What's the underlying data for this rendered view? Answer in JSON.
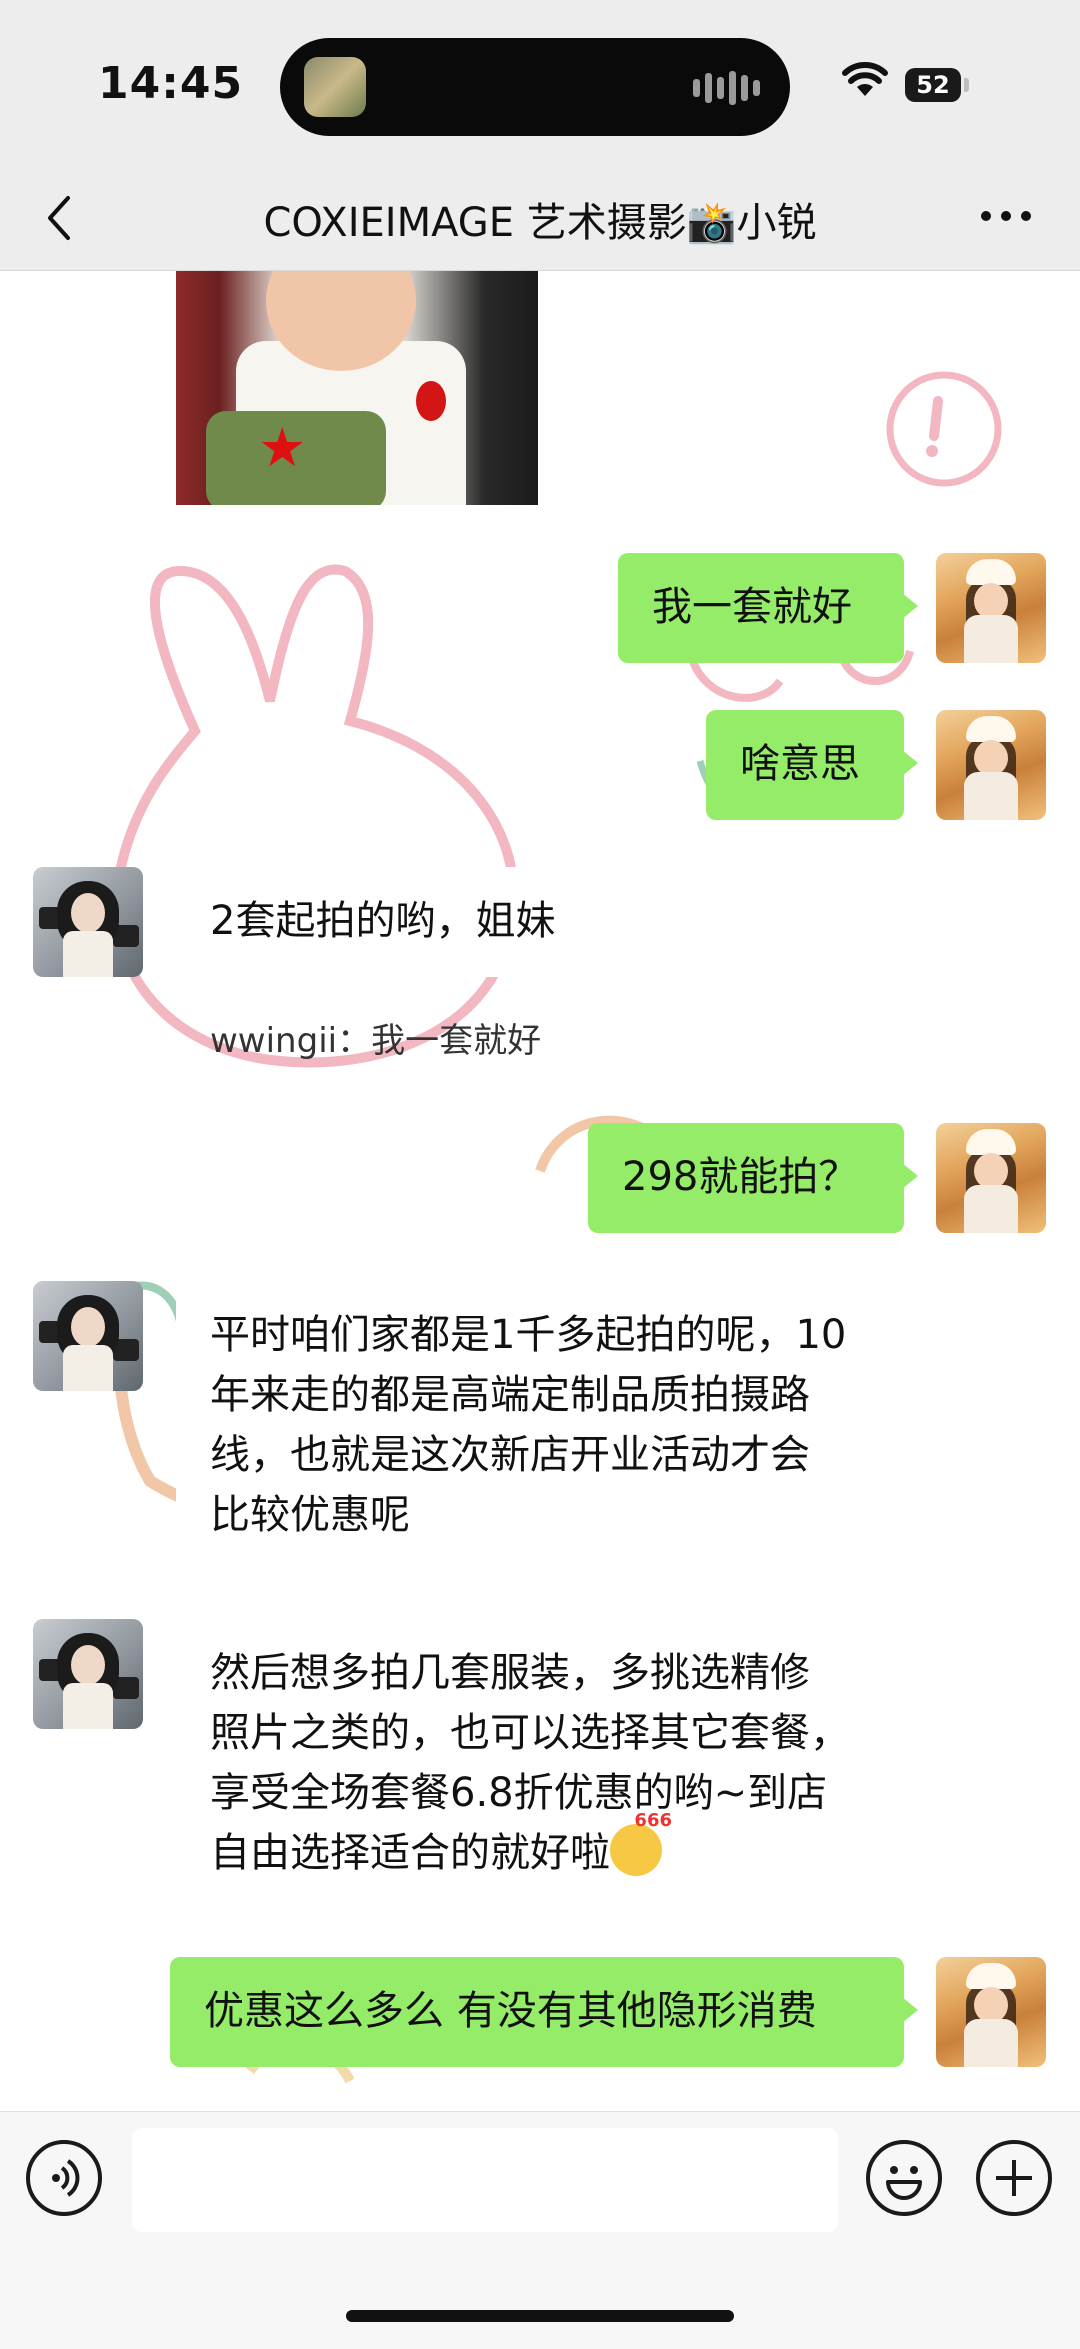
{
  "status_bar": {
    "time": "14:45",
    "battery": "52"
  },
  "nav": {
    "title": "COXIEIMAGE 艺术摄影📸小锐"
  },
  "messages": {
    "m1": "我一套就好",
    "m2": "啥意思",
    "m3": "2套起拍的哟，姐妹",
    "m3_quote": "wwingii：我一套就好",
    "m4": "298就能拍？",
    "m5_lines": [
      "平时咱们家都是1千多起拍的呢，10",
      "年来走的都是高端定制品质拍摄路",
      "线，也就是这次新店开业活动才会",
      "比较优惠呢"
    ],
    "m6_lines": [
      "然后想多拍几套服装，多挑选精修",
      "照片之类的，也可以选择其它套餐，",
      "享受全场套餐6.8折优惠的哟~到店",
      "自由选择适合的就好啦"
    ],
    "m7": "优惠这么多么 有没有其他隐形消费"
  },
  "input": {
    "value": ""
  }
}
